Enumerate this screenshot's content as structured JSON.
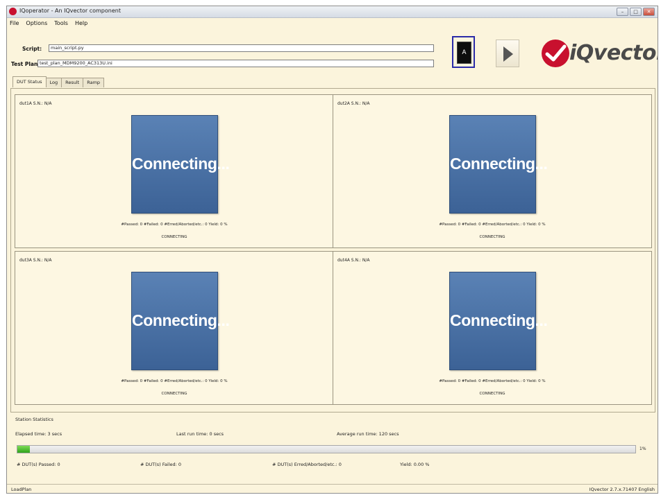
{
  "window": {
    "title": "IQoperator - An IQvector component",
    "controls": [
      "minimize-icon",
      "maximize-icon",
      "close-icon"
    ]
  },
  "menu": [
    "File",
    "Options",
    "Tools",
    "Help"
  ],
  "script": {
    "label": "Script:",
    "value": "main_script.py"
  },
  "test_plan": {
    "label": "Test Plan:",
    "value": "test_plan_MDM9200_AC313U.ini"
  },
  "buttons": {
    "a_label": "A",
    "b_icon": "play-icon"
  },
  "logo": {
    "text": "iQvector",
    "accent": "#c8102e"
  },
  "tabs": [
    "DUT Status",
    "Log",
    "Result",
    "Ramp"
  ],
  "duts": [
    {
      "title": "dut1A  S.N.: N/A",
      "box_label": "Connecting...",
      "stats": "#Passed: 0  #Failed: 0  #Erred/Aborted/etc.: 0  Yield: 0  %",
      "status": "CONNECTING"
    },
    {
      "title": "dut2A  S.N.: N/A",
      "box_label": "Connecting...",
      "stats": "#Passed: 0  #Failed: 0  #Erred/Aborted/etc.: 0  Yield: 0  %",
      "status": "CONNECTING"
    },
    {
      "title": "dut3A  S.N.: N/A",
      "box_label": "Connecting...",
      "stats": "#Passed: 0  #Failed: 0  #Erred/Aborted/etc.: 0  Yield: 0  %",
      "status": "CONNECTING"
    },
    {
      "title": "dut4A  S.N.: N/A",
      "box_label": "Connecting...",
      "stats": "#Passed: 0  #Failed: 0  #Erred/Aborted/etc.: 0  Yield: 0  %",
      "status": "CONNECTING"
    }
  ],
  "station": {
    "title": "Station Statistics",
    "elapsed": "Elapsed time:  3  secs",
    "last_run": "Last run time:  0  secs",
    "average_run": "Average run time:  120  secs",
    "progress_label": "1%",
    "progress_fraction": 0.02,
    "passed": "# DUT(s) Passed:  0",
    "failed": "# DUT(s) Failed:  0",
    "erred": "# DUT(s) Erred/Aborted/etc.:  0",
    "yield": "Yield:  0.00  %"
  },
  "statusbar": {
    "left": "LoadPlan",
    "right": "IQvector 2.7.x.71407  English"
  },
  "colors": {
    "window_bg": "#fbf4dc",
    "connecting_box": "#4a72a6",
    "progress_fill": "#3db326"
  }
}
